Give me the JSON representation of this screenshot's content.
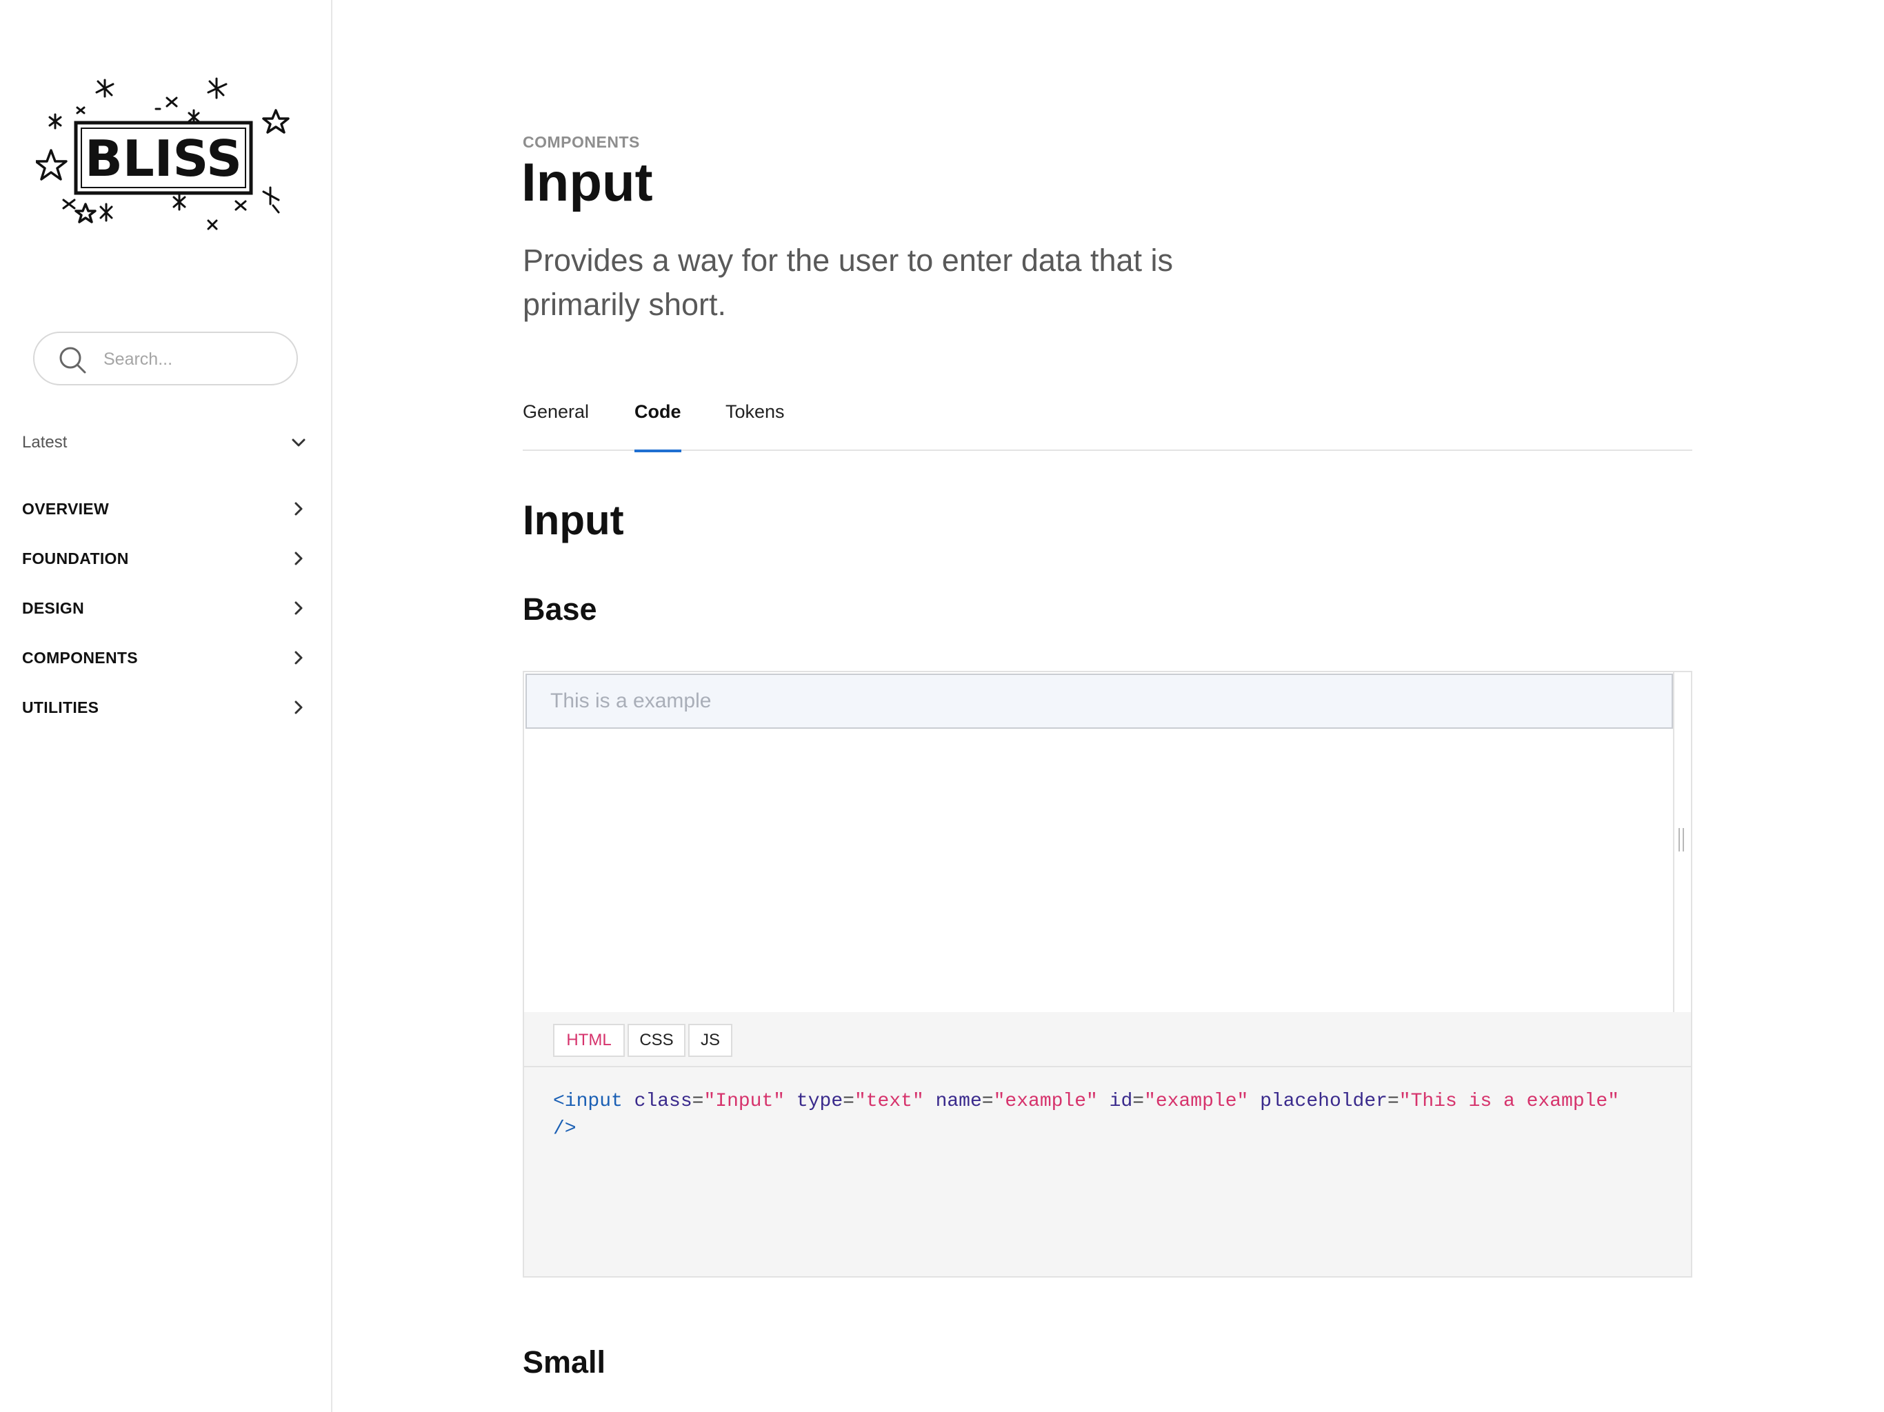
{
  "sidebar": {
    "logo_text": "BLISS",
    "search": {
      "placeholder": "Search..."
    },
    "version": {
      "label": "Latest"
    },
    "items": [
      {
        "label": "OVERVIEW"
      },
      {
        "label": "FOUNDATION"
      },
      {
        "label": "DESIGN"
      },
      {
        "label": "COMPONENTS"
      },
      {
        "label": "UTILITIES"
      }
    ]
  },
  "page": {
    "eyebrow": "COMPONENTS",
    "title": "Input",
    "description": "Provides a way for the user to enter data that is primarily short.",
    "tabs": [
      {
        "label": "General",
        "active": false
      },
      {
        "label": "Code",
        "active": true
      },
      {
        "label": "Tokens",
        "active": false
      }
    ]
  },
  "content": {
    "section_title": "Input",
    "base_title": "Base",
    "small_title": "Small",
    "example": {
      "input_placeholder": "This is a example",
      "code_tabs": [
        {
          "label": "HTML",
          "active": true
        },
        {
          "label": "CSS",
          "active": false
        },
        {
          "label": "JS",
          "active": false
        }
      ],
      "code": {
        "open": "<input",
        "attrs": [
          {
            "name": "class",
            "value": "\"Input\""
          },
          {
            "name": "type",
            "value": "\"text\""
          },
          {
            "name": "name",
            "value": "\"example\""
          },
          {
            "name": "id",
            "value": "\"example\""
          },
          {
            "name": "placeholder",
            "value": "\"This is a example\""
          }
        ],
        "close": "/>"
      }
    }
  },
  "colors": {
    "accent": "#1f6fd1",
    "code_value": "#d6336c",
    "code_tag": "#1a5fb4",
    "code_attr": "#3a2a8c",
    "muted": "#8e8e8e"
  },
  "icons": {
    "search": "search-icon",
    "version_chevron": "chevron-down-icon",
    "nav_chevron": "chevron-right-icon",
    "resize": "resize-handle-icon"
  }
}
